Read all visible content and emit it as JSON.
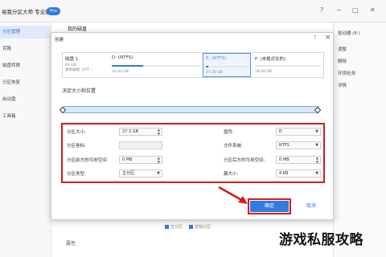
{
  "app": {
    "title": "易我分区大师 专业版",
    "badge": "Pro",
    "window_controls": [
      "?",
      "−",
      "□",
      "✕"
    ]
  },
  "sidebar": {
    "items": [
      {
        "label": "分区管理",
        "active": true
      },
      {
        "label": "克隆",
        "active": false
      },
      {
        "label": "磁盘转换",
        "active": false
      },
      {
        "label": "分区恢复",
        "active": false
      },
      {
        "label": "启动盘",
        "active": false
      },
      {
        "label": "工具箱",
        "active": false
      }
    ]
  },
  "main": {
    "title": "我的磁盘",
    "legend": [
      "主分区",
      "逻辑分区"
    ],
    "properties_label": "属性"
  },
  "right_panel": {
    "items": [
      "驱动器 (E:)",
      "调整",
      "删除",
      "环境检测",
      "详情"
    ]
  },
  "dialog": {
    "title": "创建",
    "help_icon": "?",
    "close_icon": "×",
    "disk_map": [
      {
        "name": "磁盘 1",
        "sub": "60 GB\n基本磁盘, GPT ...",
        "size": "",
        "fill": 0,
        "selected": false
      },
      {
        "name": "D: (NTFS)",
        "sub": "",
        "size": "33.43 GB",
        "fill": 0.35,
        "selected": false
      },
      {
        "name": "E: (NTFS)",
        "sub": "",
        "size": "27.30 GB",
        "fill": 0.05,
        "selected": true
      },
      {
        "name": "F: (未格式化的)",
        "sub": "",
        "size": "18.28 GB",
        "fill": 0,
        "selected": false
      }
    ],
    "section_title": "决定大小和位置",
    "form": {
      "partition_size": {
        "label": "分区大小:",
        "value": "27.3 GB"
      },
      "drive_letter": {
        "label": "盘符:",
        "value": "E:"
      },
      "partition_label": {
        "label": "分区卷标:",
        "value": ""
      },
      "file_system": {
        "label": "文件系统:",
        "value": "NTFS"
      },
      "space_before": {
        "label": "分区前方的可用空间:",
        "value": "0 MB"
      },
      "space_after": {
        "label": "分区后方的可用空间:",
        "value": "0 MB"
      },
      "partition_type": {
        "label": "分区类型:",
        "value": "主分区"
      },
      "cluster_size": {
        "label": "簇大小:",
        "value": "4 KB"
      }
    },
    "ok_label": "确定",
    "cancel_label": "取消"
  },
  "colors": {
    "accent": "#2f7bdf",
    "highlight": "#d71920"
  },
  "watermark": "游戏私服攻略"
}
